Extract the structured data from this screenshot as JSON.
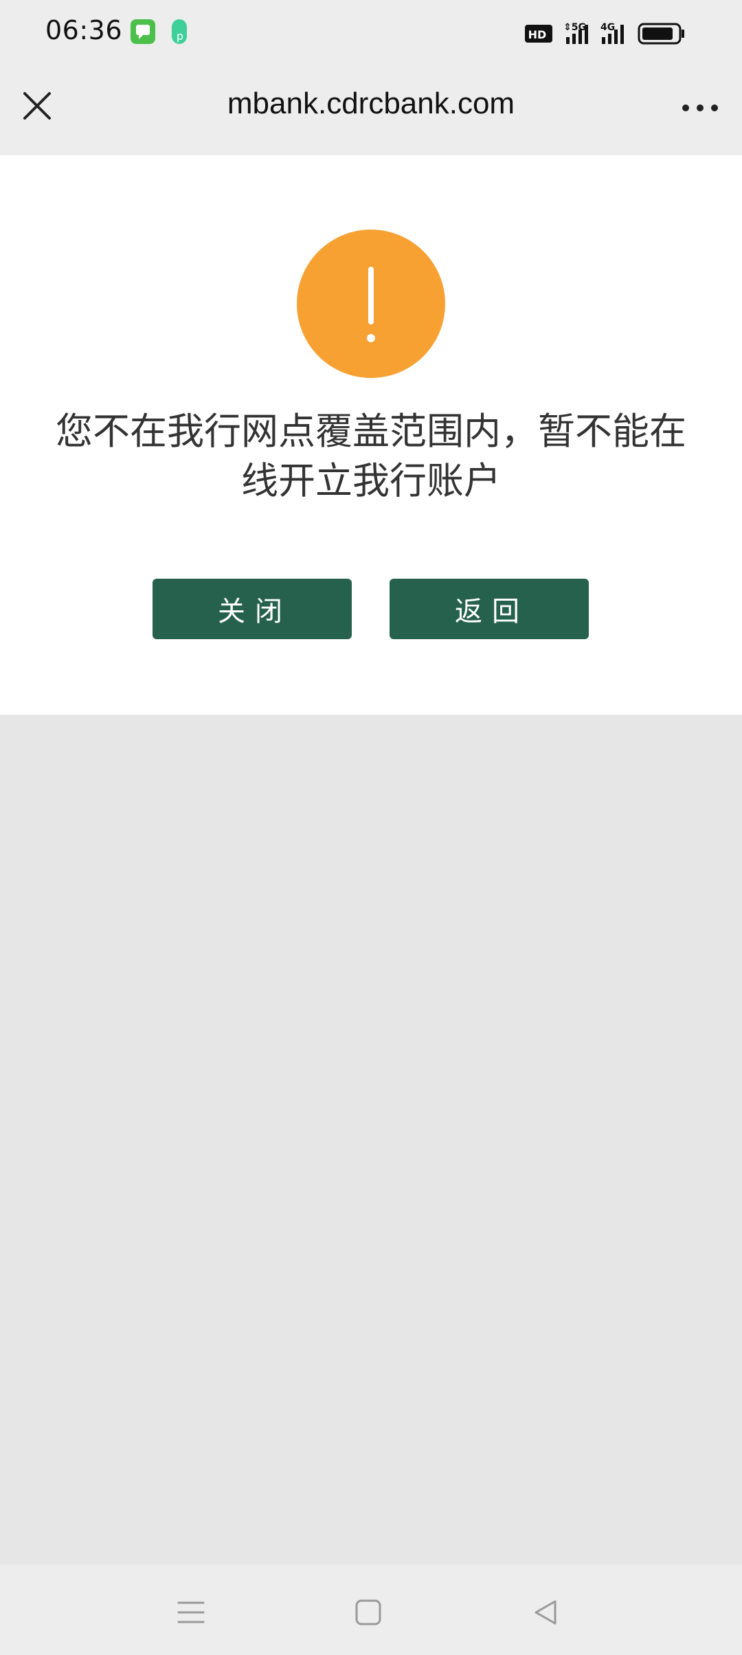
{
  "status_bar": {
    "time": "06:36",
    "icons": [
      "messages-app-icon",
      "p-app-icon",
      "hd-icon",
      "5g-signal-icon",
      "4g-signal-icon",
      "battery-icon"
    ]
  },
  "titlebar": {
    "url": "mbank.cdrcbank.com",
    "close_icon": "close-icon",
    "more_icon": "more-icon"
  },
  "alert": {
    "icon": "warning-icon",
    "icon_color": "#f8a133",
    "message": "您不在我行网点覆盖范围内，暂不能在线开立我行账户",
    "close_label": "关闭",
    "back_label": "返回",
    "button_color": "#26614d"
  },
  "navbar": {
    "icons": [
      "menu-icon",
      "home-icon",
      "back-icon"
    ]
  }
}
